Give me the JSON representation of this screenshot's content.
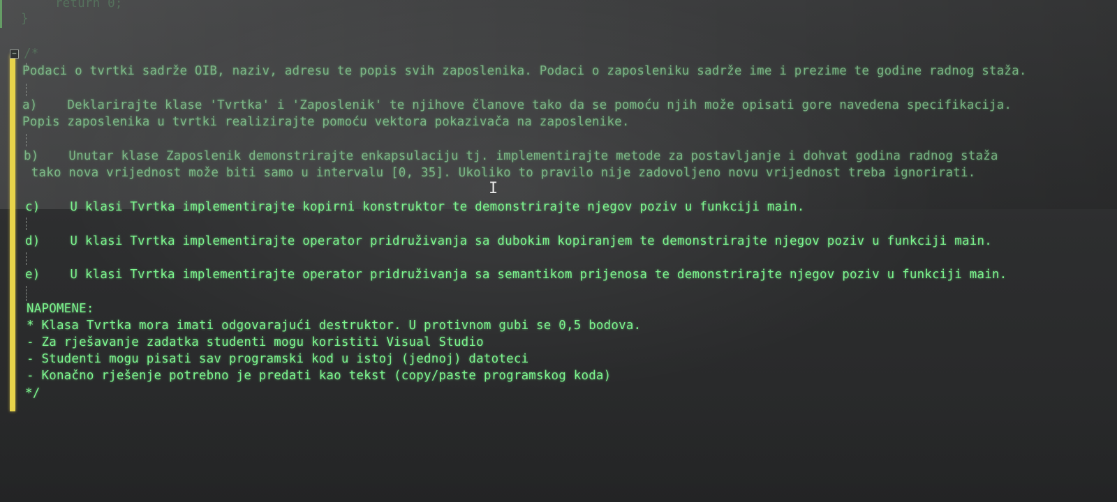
{
  "code_header": {
    "return_line": "    return 0;",
    "close_brace": "}",
    "comment_open": "/*"
  },
  "comment": {
    "intro": "Podaci o tvrtki sadrže OIB, naziv, adresu te popis svih zaposlenika. Podaci o zaposleniku sadrže ime i prezime te godine radnog staža.",
    "task_a_line1": "a)    Deklarirajte klase 'Tvrtka' i 'Zaposlenik' te njihove članove tako da se pomoću njih može opisati gore navedena specifikacija.",
    "task_a_line2": "Popis zaposlenika u tvrtki realizirajte pomoću vektora pokazivača na zaposlenike.",
    "task_b_line1": "b)    Unutar klase Zaposlenik demonstrirajte enkapsulaciju tj. implementirajte metode za postavljanje i dohvat godina radnog staža",
    "task_b_line2": " tako nova vrijednost može biti samo u intervalu [0, 35]. Ukoliko to pravilo nije zadovoljeno novu vrijednost treba ignorirati.",
    "task_c": "c)    U klasi Tvrtka implementirajte kopirni konstruktor te demonstrirajte njegov poziv u funkciji main.",
    "task_d": "d)    U klasi Tvrtka implementirajte operator pridruživanja sa dubokim kopiranjem te demonstrirajte njegov poziv u funkciji main.",
    "task_e": "e)    U klasi Tvrtka implementirajte operator pridruživanja sa semantikom prijenosa te demonstrirajte njegov poziv u funkciji main.",
    "notes_heading": "NAPOMENE:",
    "note_1": "* Klasa Tvrtka mora imati odgovarajući destruktor. U protivnom gubi se 0,5 bodova.",
    "note_2": "- Za rješavanje zadatka studenti mogu koristiti Visual Studio",
    "note_3": "- Studenti mogu pisati sav programski kod u istoj (jednoj) datoteci",
    "note_4": "- Konačno rješenje potrebno je predati kao tekst (copy/paste programskog koda)",
    "comment_close": "*/"
  },
  "colors": {
    "code_text": "#7cf58e",
    "change_bar": "#e7d34a",
    "background": "#2c2d2e"
  },
  "icons": {
    "fold": "collapse-minus",
    "cursor": "i-beam"
  }
}
